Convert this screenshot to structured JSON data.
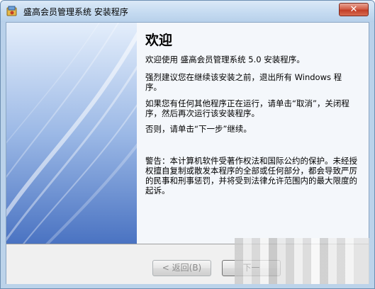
{
  "window": {
    "title": "盛高会员管理系统 安装程序",
    "close_label": "✕"
  },
  "content": {
    "heading": "欢迎",
    "paragraph1": "欢迎使用 盛高会员管理系统 5.0 安装程序。",
    "paragraph2": "强烈建议您在继续该安装之前，退出所有 Windows 程序。",
    "paragraph3": "如果您有任何其他程序正在运行，请单击“取消”，关闭程序，然后再次运行该安装程序。",
    "paragraph4": "否则，请单击“下一步”继续。",
    "warning": "警告：本计算机软件受著作权法和国际公约的保护。未经授权擅自复制或散发本程序的全部或任何部分，都会导致严厉的民事和刑事惩罚，并将受到法律允许范围内的最大限度的起诉。"
  },
  "buttons": {
    "back_label": "< 返回(B)",
    "next_label": "下一"
  }
}
